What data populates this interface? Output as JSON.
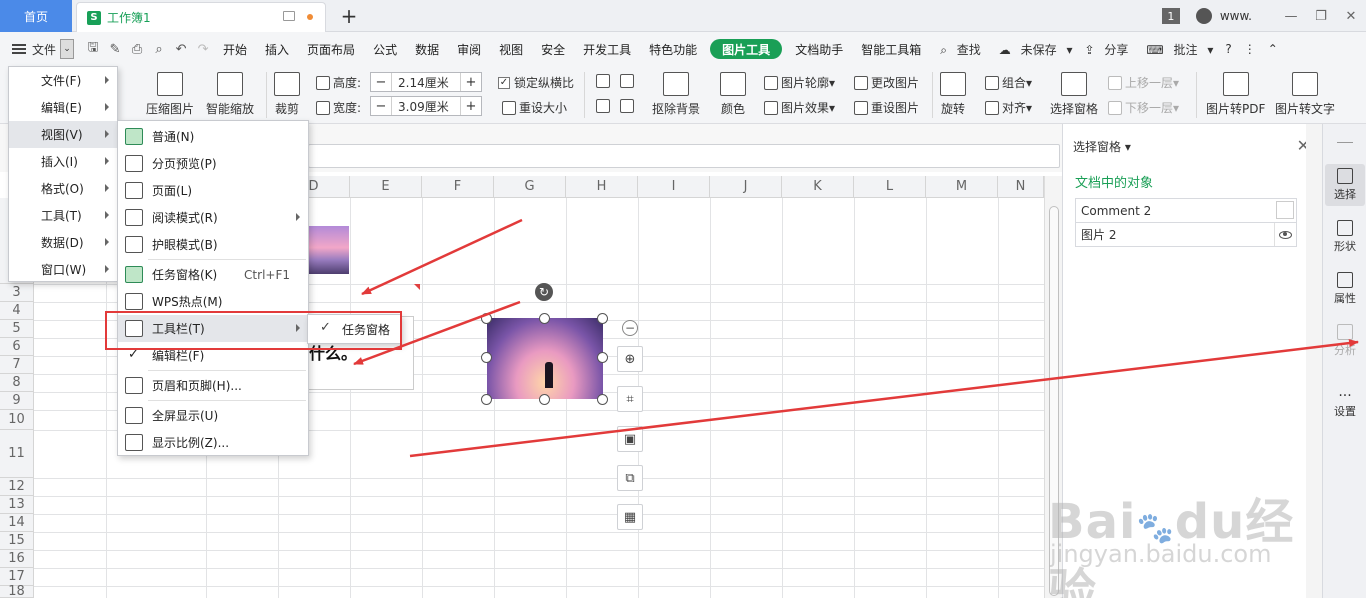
{
  "titlebar": {
    "home_tab": "首页",
    "doc_tab": "工作簿1",
    "doc_logo": "S",
    "badge": "1",
    "user": "www."
  },
  "menubar": {
    "file_label": "文件",
    "tabs": [
      "开始",
      "插入",
      "页面布局",
      "公式",
      "数据",
      "审阅",
      "视图",
      "安全",
      "开发工具",
      "特色功能",
      "图片工具",
      "文档助手",
      "智能工具箱"
    ],
    "active_tab": "图片工具",
    "search": "查找",
    "unsaved": "未保存",
    "share": "分享",
    "annotate": "批注",
    "help": "?"
  },
  "ribbon": {
    "compress": "压缩图片",
    "smart_zoom": "智能缩放",
    "crop": "裁剪",
    "height_label": "高度:",
    "height_value": "2.14厘米",
    "width_label": "宽度:",
    "width_value": "3.09厘米",
    "lock_ratio": "锁定纵横比",
    "reset_size": "重设大小",
    "remove_bg": "抠除背景",
    "color": "颜色",
    "outline": "图片轮廓",
    "effect": "图片效果",
    "change_pic": "更改图片",
    "reset_pic": "重设图片",
    "rotate": "旋转",
    "group": "组合",
    "align": "对齐",
    "select_pane": "选择窗格",
    "bring_forward": "上移一层",
    "send_backward": "下移一层",
    "to_pdf": "图片转PDF",
    "to_text": "图片转文字"
  },
  "file_menu": {
    "items": [
      {
        "label": "文件(F)"
      },
      {
        "label": "编辑(E)"
      },
      {
        "label": "视图(V)"
      },
      {
        "label": "插入(I)"
      },
      {
        "label": "格式(O)"
      },
      {
        "label": "工具(T)"
      },
      {
        "label": "数据(D)"
      },
      {
        "label": "窗口(W)"
      }
    ],
    "highlighted": "视图(V)"
  },
  "view_menu": {
    "normal": "普通(N)",
    "page_break": "分页预览(P)",
    "page": "页面(L)",
    "reading": "阅读模式(R)",
    "eye_care": "护眼模式(B)",
    "task_pane": "任务窗格(K)",
    "task_pane_shortcut": "Ctrl+F1",
    "wps_hot": "WPS热点(M)",
    "toolbar": "工具栏(T)",
    "edit_bar": "编辑栏(F)",
    "header_footer": "页眉和页脚(H)...",
    "fullscreen": "全屏显示(U)",
    "zoom": "显示比例(Z)..."
  },
  "toolbar_submenu": {
    "task_pane": "任务窗格"
  },
  "sheet": {
    "columns": [
      "D",
      "E",
      "F",
      "G",
      "H",
      "I",
      "J",
      "K",
      "L",
      "M",
      "N"
    ],
    "rows": [
      "3",
      "4",
      "5",
      "6",
      "7",
      "8",
      "9",
      "10",
      "11",
      "12",
      "13",
      "14",
      "15",
      "16",
      "17",
      "18"
    ],
    "text_fragment": "什么。"
  },
  "task_pane": {
    "title": "选择窗格",
    "subtitle": "文档中的对象",
    "objects": [
      "Comment 2",
      "图片 2"
    ]
  },
  "vtoolbar": {
    "select": "选择",
    "shape": "形状",
    "props": "属性",
    "analyze": "分析",
    "settings": "设置"
  },
  "watermark": {
    "brand": "Bai",
    "brand2": "du",
    "cn": "经验",
    "url": "jingyan.baidu.com"
  },
  "colors": {
    "accent_green": "#1a9f56",
    "home_blue": "#4b8ae8",
    "annotation_red": "#e23a3a"
  }
}
